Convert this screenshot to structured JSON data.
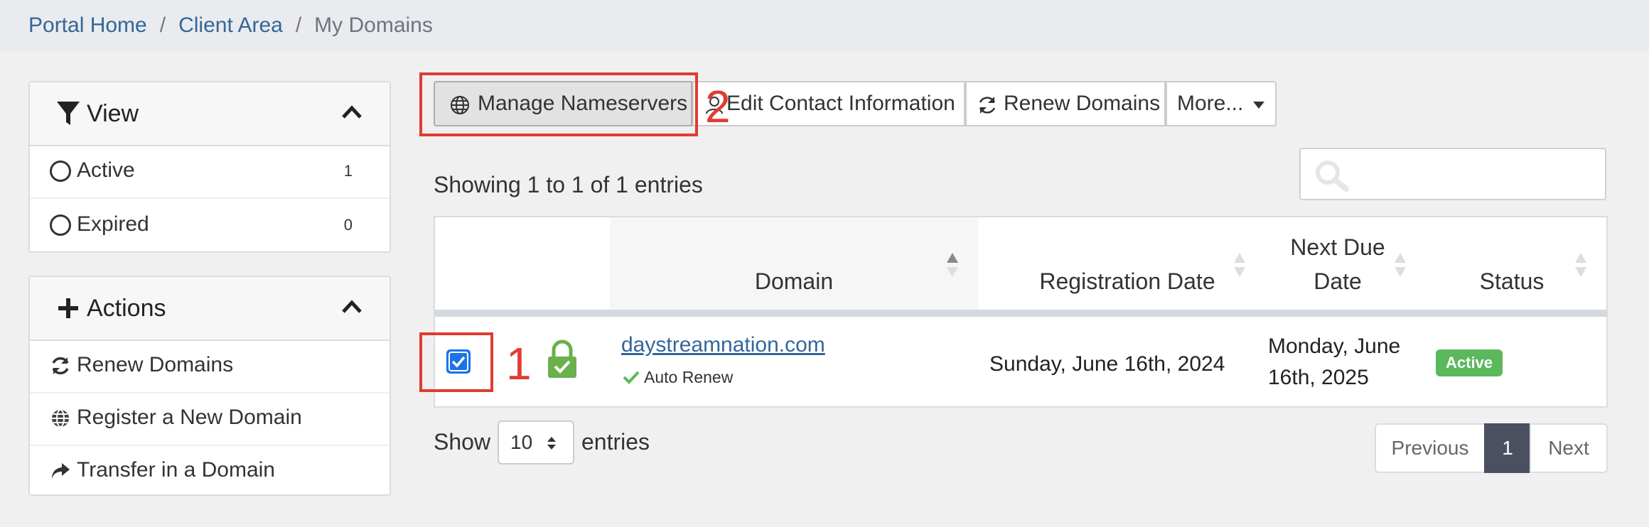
{
  "breadcrumb": {
    "home": "Portal Home",
    "client_area": "Client Area",
    "current": "My Domains",
    "separator": "/"
  },
  "sidebar": {
    "view": {
      "title": "View",
      "items": [
        {
          "label": "Active",
          "count": "1"
        },
        {
          "label": "Expired",
          "count": "0"
        }
      ]
    },
    "actions": {
      "title": "Actions",
      "items": [
        {
          "label": "Renew Domains",
          "icon": "refresh-icon"
        },
        {
          "label": "Register a New Domain",
          "icon": "globe-icon"
        },
        {
          "label": "Transfer in a Domain",
          "icon": "share-arrow-icon"
        }
      ]
    }
  },
  "toolbar": {
    "manage_nameservers": "Manage Nameservers",
    "edit_contact": "Edit Contact Information",
    "renew_domains": "Renew Domains",
    "more": "More..."
  },
  "annotations": {
    "marker_1": "1",
    "marker_2": "2",
    "color": "#e03c31"
  },
  "table_info": "Showing 1 to 1 of 1 entries",
  "search": {
    "placeholder": ""
  },
  "table": {
    "headers": {
      "domain": "Domain",
      "registration_date": "Registration Date",
      "next_due_date_line1": "Next Due",
      "next_due_date_line2": "Date",
      "status": "Status"
    },
    "rows": [
      {
        "checked": true,
        "domain": "daystreamnation.com",
        "auto_renew": "Auto Renew",
        "registration_date": "Sunday, June 16th, 2024",
        "next_due_line1": "Monday, June",
        "next_due_line2": "16th, 2025",
        "status": "Active"
      }
    ]
  },
  "footer": {
    "show_label": "Show",
    "page_size": "10",
    "entries_label": "entries",
    "previous": "Previous",
    "current_page": "1",
    "next": "Next"
  },
  "colors": {
    "link": "#336699",
    "badge_active": "#5cb85c",
    "accent_checkbox": "#1a73e8"
  }
}
